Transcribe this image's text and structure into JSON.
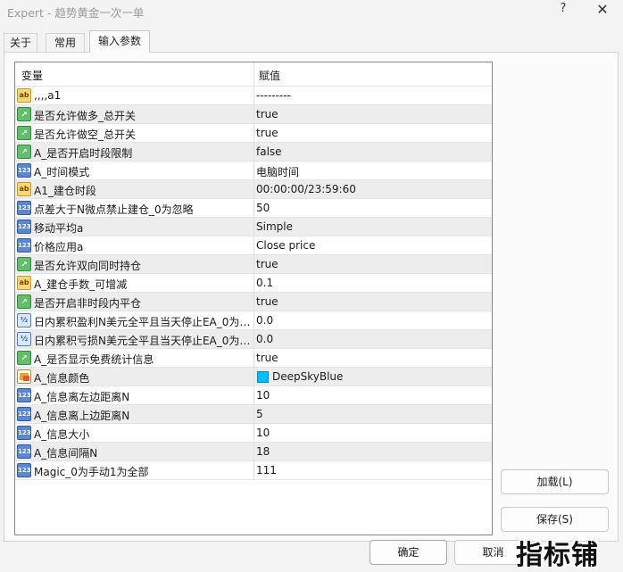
{
  "window": {
    "title": "Expert - 趋势黄金一次一单",
    "help": "?",
    "close": "✕"
  },
  "tabs": [
    {
      "label": "关于",
      "active": false
    },
    {
      "label": "常用",
      "active": false
    },
    {
      "label": "输入参数",
      "active": true
    }
  ],
  "grid": {
    "columns": [
      "变量",
      "赋值"
    ],
    "rows": [
      {
        "type": "str",
        "icon": "ab",
        "name": ",,,,a1",
        "value": "---------"
      },
      {
        "type": "bool",
        "icon": "bool",
        "name": "是否允许做多_总开关",
        "value": "true"
      },
      {
        "type": "bool",
        "icon": "bool",
        "name": "是否允许做空_总开关",
        "value": "true"
      },
      {
        "type": "bool",
        "icon": "bool",
        "name": "A_是否开启时段限制",
        "value": "false"
      },
      {
        "type": "int",
        "icon": "123",
        "name": "A_时间模式",
        "value": "电脑时间"
      },
      {
        "type": "str",
        "icon": "ab",
        "name": "A1_建仓时段",
        "value": "00:00:00/23:59:60"
      },
      {
        "type": "int",
        "icon": "123",
        "name": "点差大于N微点禁止建仓_0为忽略",
        "value": "50"
      },
      {
        "type": "int",
        "icon": "123",
        "name": "移动平均a",
        "value": "Simple"
      },
      {
        "type": "int",
        "icon": "123",
        "name": "价格应用a",
        "value": "Close price"
      },
      {
        "type": "bool",
        "icon": "bool",
        "name": "是否允许双向同时持仓",
        "value": "true"
      },
      {
        "type": "str",
        "icon": "ab",
        "name": "A_建仓手数_可增减",
        "value": "0.1"
      },
      {
        "type": "bool",
        "icon": "bool",
        "name": "是否开启非时段内平仓",
        "value": "true"
      },
      {
        "type": "dbl",
        "icon": "½",
        "name": "日内累积盈利N美元全平且当天停止EA_0为?..",
        "value": "0.0"
      },
      {
        "type": "dbl",
        "icon": "½",
        "name": "日内累积亏损N美元全平且当天停止EA_0为?..",
        "value": "0.0"
      },
      {
        "type": "bool",
        "icon": "bool",
        "name": "A_是否显示免费统计信息",
        "value": "true"
      },
      {
        "type": "color",
        "icon": "color",
        "name": "A_信息颜色",
        "value": "DeepSkyBlue",
        "swatch": "#00bfff"
      },
      {
        "type": "int",
        "icon": "123",
        "name": "A_信息离左边距离N",
        "value": "10"
      },
      {
        "type": "int",
        "icon": "123",
        "name": "A_信息离上边距离N",
        "value": "5"
      },
      {
        "type": "int",
        "icon": "123",
        "name": "A_信息大小",
        "value": "10"
      },
      {
        "type": "int",
        "icon": "123",
        "name": "A_信息间隔N",
        "value": "18"
      },
      {
        "type": "int",
        "icon": "123",
        "name": "Magic_0为手动1为全部",
        "value": "111"
      }
    ]
  },
  "buttons": {
    "load": "加载(L)",
    "save": "保存(S)",
    "ok": "确定",
    "cancel": "取消"
  },
  "watermark": "指标铺"
}
